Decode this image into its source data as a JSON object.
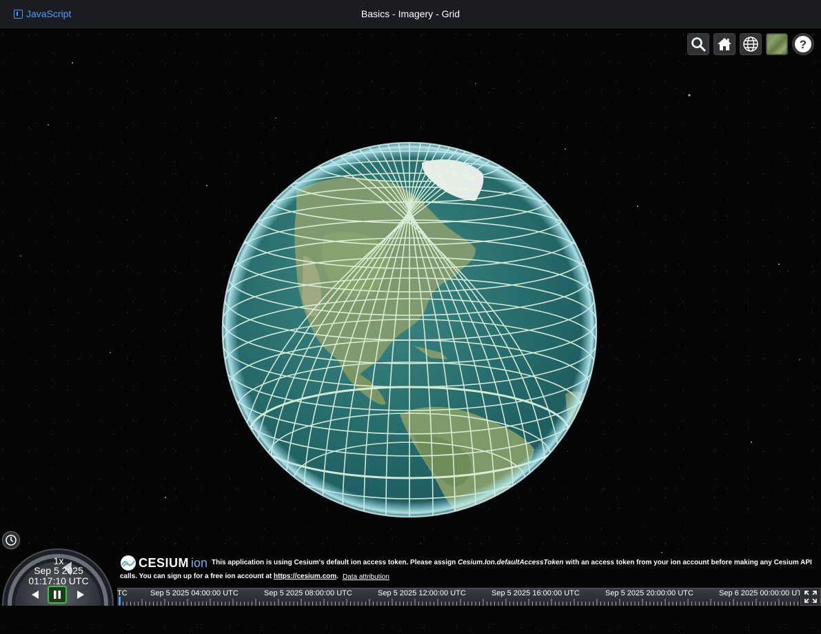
{
  "header": {
    "language_label": "JavaScript",
    "title": "Basics - Imagery - Grid"
  },
  "toolbar": {
    "items": [
      "search-icon",
      "home-icon",
      "globe-icon",
      "imagery-layer-picker",
      "help-icon"
    ]
  },
  "animation": {
    "speed": "1x",
    "date": "Sep 5 2025",
    "time": "01:17:10 UTC"
  },
  "credits": {
    "logo_text": "CESIUM",
    "logo_suffix": "ion",
    "message_1": "This application is using Cesium's default ion access token. Please assign ",
    "message_code": "Cesium.Ion.defaultAccessToken",
    "message_2": " with an access token from your ion account before making any Cesium API calls. You can sign up for a free ion account at ",
    "link": "https://cesium.com",
    "message_3": ".",
    "data_attribution": "Data attribution"
  },
  "timeline": {
    "labels": [
      "TC",
      "Sep 5 2025 04:00:00 UTC",
      "Sep 5 2025 08:00:00 UTC",
      "Sep 5 2025 12:00:00 UTC",
      "Sep 5 2025 16:00:00 UTC",
      "Sep 5 2025 20:00:00 UTC",
      "Sep 6 2025 00:00:00 UTC"
    ]
  },
  "colors": {
    "accent": "#4a9eff",
    "ocean": "#2a6e6e",
    "grid": "#dff5dd"
  }
}
